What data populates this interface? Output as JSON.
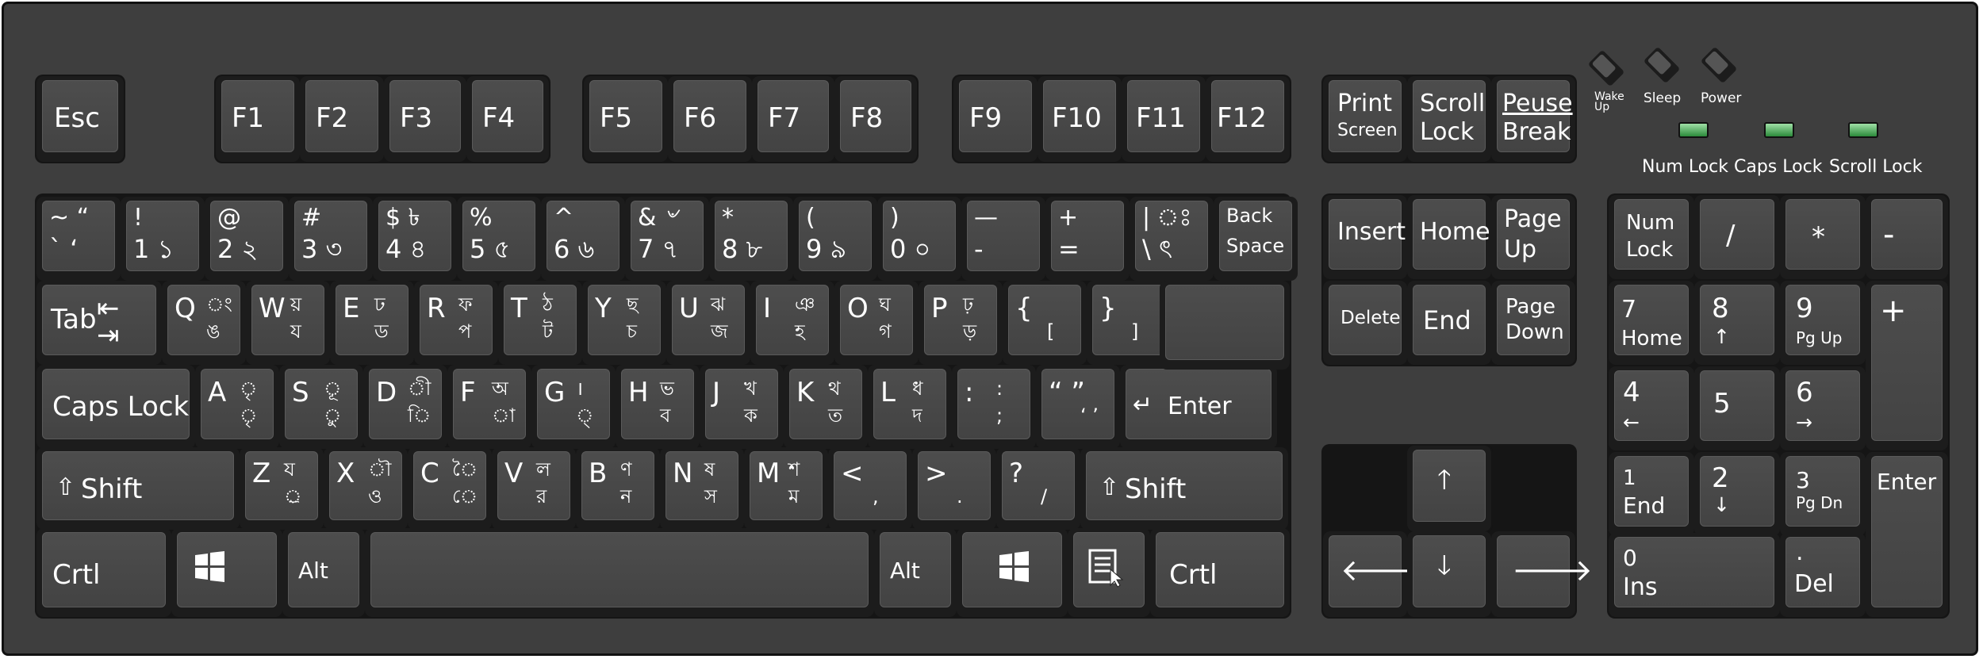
{
  "colors": {
    "case": "#3e3e3e",
    "key_face": "#484848",
    "key_base": "#1c1c1c",
    "led_green": "#4caf50",
    "text": "#ffffff"
  },
  "function_row": {
    "esc": "Esc",
    "f_keys": [
      "F1",
      "F2",
      "F3",
      "F4",
      "F5",
      "F6",
      "F7",
      "F8",
      "F9",
      "F10",
      "F11",
      "F12"
    ],
    "print_screen": {
      "line1": "Print",
      "line2": "Screen"
    },
    "scroll_lock": {
      "line1": "Scroll",
      "line2": "Lock"
    },
    "pause_break": {
      "line1": "Peuse",
      "line2": "Break"
    }
  },
  "power_keys": [
    "Wake Up",
    "Sleep",
    "Power"
  ],
  "indicators": [
    "Num Lock",
    "Caps Lock",
    "Scroll Lock"
  ],
  "number_row": [
    {
      "top": "~ “",
      "bottom": "` ‘"
    },
    {
      "top": "!",
      "bottom": "1 ১"
    },
    {
      "top": "@",
      "bottom": "2 ২"
    },
    {
      "top": "#",
      "bottom": "3 ৩"
    },
    {
      "top": "$ ৳",
      "bottom": "4 ৪"
    },
    {
      "top": "%",
      "bottom": "5 ৫"
    },
    {
      "top": "^",
      "bottom": "6 ৬"
    },
    {
      "top": "& ৺",
      "bottom": "7 ৭"
    },
    {
      "top": "*",
      "bottom": "8 ৮"
    },
    {
      "top": "(",
      "bottom": "9 ৯"
    },
    {
      "top": ")",
      "bottom": "0 ০"
    },
    {
      "top": "—",
      "bottom": "-"
    },
    {
      "top": "+",
      "bottom": "="
    },
    {
      "top": "| ঃ",
      "bottom": "\\ ৎ"
    },
    {
      "top": "Back",
      "bottom": "Space"
    }
  ],
  "qwerty_row": [
    {
      "main": "Tab"
    },
    {
      "main": "Q",
      "b1": "ং",
      "b2": "ঙ"
    },
    {
      "main": "W",
      "b1": "য়",
      "b2": "য"
    },
    {
      "main": "E",
      "b1": "ঢ",
      "b2": "ড"
    },
    {
      "main": "R",
      "b1": "ফ",
      "b2": "প"
    },
    {
      "main": "T",
      "b1": "ঠ",
      "b2": "ট"
    },
    {
      "main": "Y",
      "b1": "ছ",
      "b2": "চ"
    },
    {
      "main": "U",
      "b1": "ঝ",
      "b2": "জ"
    },
    {
      "main": "I",
      "b1": "ঞ",
      "b2": "হ"
    },
    {
      "main": "O",
      "b1": "ঘ",
      "b2": "গ"
    },
    {
      "main": "P",
      "b1": "ঢ়",
      "b2": "ড়"
    },
    {
      "main": "{",
      "b1": "",
      "b2": "["
    },
    {
      "main": "}",
      "b1": "",
      "b2": "]"
    }
  ],
  "home_row": [
    {
      "main": "Caps Lock"
    },
    {
      "main": "A",
      "b1": "ৃ",
      "b2": "ৃ"
    },
    {
      "main": "S",
      "b1": "ূ",
      "b2": "ু"
    },
    {
      "main": "D",
      "b1": "ী",
      "b2": "ি"
    },
    {
      "main": "F",
      "b1": "অ",
      "b2": "া"
    },
    {
      "main": "G",
      "b1": "।",
      "b2": "্"
    },
    {
      "main": "H",
      "b1": "ভ",
      "b2": "ব"
    },
    {
      "main": "J",
      "b1": "খ",
      "b2": "ক"
    },
    {
      "main": "K",
      "b1": "থ",
      "b2": "ত"
    },
    {
      "main": "L",
      "b1": "ধ",
      "b2": "দ"
    },
    {
      "main": ":",
      "b1": ":",
      "b2": ";"
    },
    {
      "main": "“ ”",
      "b1": "",
      "b2": "‘ ’"
    },
    {
      "main": "Enter"
    }
  ],
  "shift_row": [
    {
      "main": "Shift"
    },
    {
      "main": "Z",
      "b1": "য",
      "b2": "্র"
    },
    {
      "main": "X",
      "b1": "ৗ",
      "b2": "ও"
    },
    {
      "main": "C",
      "b1": "ৈ",
      "b2": "ে"
    },
    {
      "main": "V",
      "b1": "ল",
      "b2": "র"
    },
    {
      "main": "B",
      "b1": "ণ",
      "b2": "ন"
    },
    {
      "main": "N",
      "b1": "ষ",
      "b2": "স"
    },
    {
      "main": "M",
      "b1": "শ",
      "b2": "ম"
    },
    {
      "main": "<",
      "b1": "",
      "b2": ","
    },
    {
      "main": ">",
      "b1": "",
      "b2": "."
    },
    {
      "main": "?",
      "b1": "",
      "b2": "/"
    },
    {
      "main": "Shift"
    }
  ],
  "bottom_row": {
    "ctrl_left": "Crtl",
    "alt_left": "Alt",
    "alt_right": "Alt",
    "ctrl_right": "Crtl"
  },
  "nav_cluster": {
    "insert": "Insert",
    "home": "Home",
    "page_up": {
      "line1": "Page",
      "line2": "Up"
    },
    "delete": "Delete",
    "end": "End",
    "page_down": {
      "line1": "Page",
      "line2": "Down"
    }
  },
  "numpad": {
    "num_lock": {
      "line1": "Num",
      "line2": "Lock"
    },
    "divide": "/",
    "multiply": "*",
    "minus": "-",
    "plus": "+",
    "k7": {
      "num": "7",
      "sub": "Home"
    },
    "k8": {
      "num": "8",
      "sub": "↑"
    },
    "k9": {
      "num": "9",
      "sub": "Pg Up"
    },
    "k4": {
      "num": "4",
      "sub": "←"
    },
    "k5": {
      "num": "5"
    },
    "k6": {
      "num": "6",
      "sub": "→"
    },
    "k1": {
      "num": "1",
      "sub": "End"
    },
    "k2": {
      "num": "2",
      "sub": "↓"
    },
    "k3": {
      "num": "3",
      "sub": "Pg Dn"
    },
    "k0": {
      "num": "0",
      "sub": "Ins"
    },
    "kdot": {
      "num": ".",
      "sub": "Del"
    },
    "enter": "Enter"
  }
}
